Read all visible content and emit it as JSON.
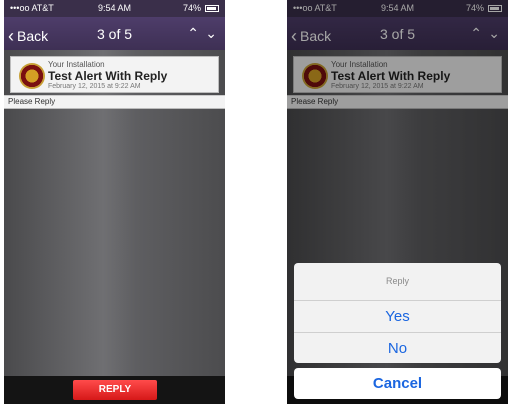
{
  "status": {
    "carrier": "•••oo AT&T",
    "time": "9:54 AM",
    "battery": "74%"
  },
  "nav": {
    "back": "Back",
    "title": "3 of 5",
    "up": "⌃",
    "down": "⌄"
  },
  "alert": {
    "installation": "Your Installation",
    "title": "Test Alert With Reply",
    "date": "February 12, 2015 at 9:22 AM",
    "body": "Please Reply"
  },
  "reply_button": "REPLY",
  "sheet": {
    "title": "Reply",
    "options": [
      "Yes",
      "No"
    ],
    "cancel": "Cancel"
  },
  "colors": {
    "nav": "#4e3d6a",
    "reply": "#e01f1f",
    "action": "#1b66e0"
  }
}
